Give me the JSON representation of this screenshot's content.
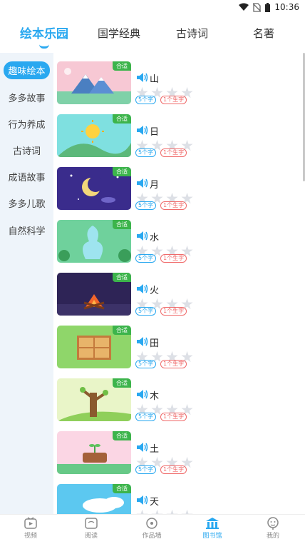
{
  "status": {
    "time": "10:36"
  },
  "tabs": [
    {
      "label": "绘本乐园"
    },
    {
      "label": "国学经典"
    },
    {
      "label": "古诗词"
    },
    {
      "label": "名著"
    }
  ],
  "sidebar": {
    "items": [
      {
        "label": "趣味绘本"
      },
      {
        "label": "多多故事"
      },
      {
        "label": "行为养成"
      },
      {
        "label": "古诗词"
      },
      {
        "label": "成语故事"
      },
      {
        "label": "多多儿歌"
      },
      {
        "label": "自然科学"
      }
    ]
  },
  "cards": [
    {
      "title": "山",
      "badge": "合适",
      "words": "5个字",
      "new_words": "1个生字",
      "rating": 0
    },
    {
      "title": "日",
      "badge": "合适",
      "words": "5个字",
      "new_words": "1个生字",
      "rating": 0
    },
    {
      "title": "月",
      "badge": "合适",
      "words": "5个字",
      "new_words": "1个生字",
      "rating": 0
    },
    {
      "title": "水",
      "badge": "合适",
      "words": "5个字",
      "new_words": "1个生字",
      "rating": 0
    },
    {
      "title": "火",
      "badge": "合适",
      "words": "5个字",
      "new_words": "1个生字",
      "rating": 0
    },
    {
      "title": "田",
      "badge": "合适",
      "words": "5个字",
      "new_words": "1个生字",
      "rating": 0
    },
    {
      "title": "木",
      "badge": "合适",
      "words": "5个字",
      "new_words": "1个生字",
      "rating": 0
    },
    {
      "title": "土",
      "badge": "合适",
      "words": "5个字",
      "new_words": "1个生字",
      "rating": 0
    },
    {
      "title": "天",
      "badge": "合适",
      "words": "",
      "new_words": "",
      "rating": 0
    }
  ],
  "bottom_nav": {
    "items": [
      {
        "label": "视频",
        "icon": "video-icon"
      },
      {
        "label": "阅读",
        "icon": "book-icon"
      },
      {
        "label": "作品墙",
        "icon": "works-icon"
      },
      {
        "label": "图书馆",
        "icon": "library-icon"
      },
      {
        "label": "我的",
        "icon": "profile-icon"
      }
    ]
  },
  "colors": {
    "accent": "#29a8f0",
    "badge": "#3cb44b",
    "tag_red": "#f06a6a",
    "sidebar_bg": "#eef4fa"
  }
}
